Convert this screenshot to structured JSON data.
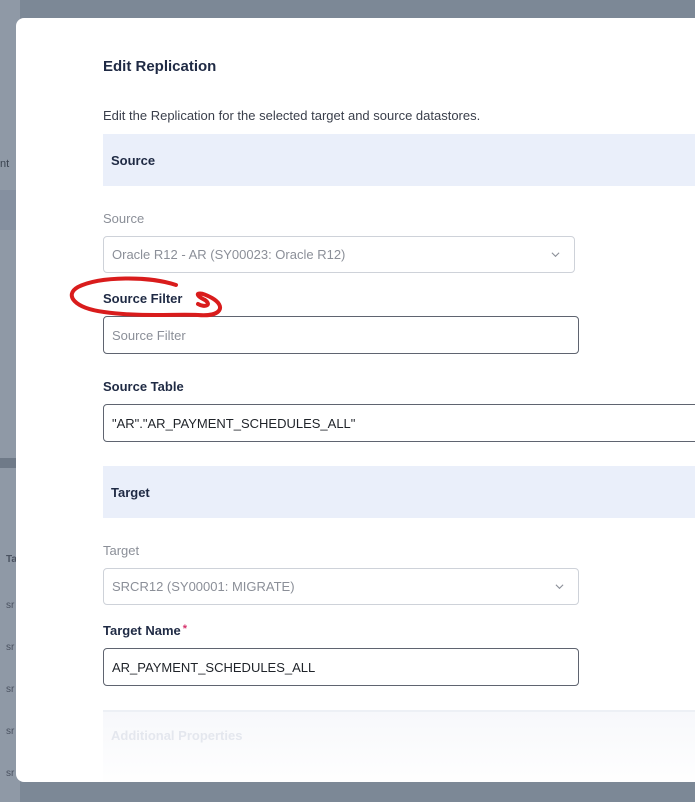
{
  "background": {
    "row_labels": [
      "nt",
      "Ta",
      "sr",
      "sr",
      "sr",
      "sr",
      "sr"
    ]
  },
  "modal": {
    "title": "Edit Replication",
    "description": "Edit the Replication for the selected target and source datastores.",
    "source_section": {
      "header": "Source",
      "source_label": "Source",
      "source_value": "Oracle R12 - AR (SY00023: Oracle R12)",
      "filter_label": "Source Filter",
      "filter_placeholder": "Source Filter",
      "table_label": "Source Table",
      "table_value": "\"AR\".\"AR_PAYMENT_SCHEDULES_ALL\""
    },
    "target_section": {
      "header": "Target",
      "target_label": "Target",
      "target_value": "SRCR12 (SY00001: MIGRATE)",
      "name_label": "Target Name",
      "required_marker": "*",
      "name_value": "AR_PAYMENT_SCHEDULES_ALL"
    },
    "additional_header": "Additional Properties"
  },
  "colors": {
    "overlay": "#7c8896",
    "section_bg": "#eaeffa",
    "title_text": "#1f2a44",
    "annotation_red": "#d91c1c",
    "required": "#d6336c"
  },
  "icons": {
    "select_chevron": "chevron-down-icon"
  }
}
